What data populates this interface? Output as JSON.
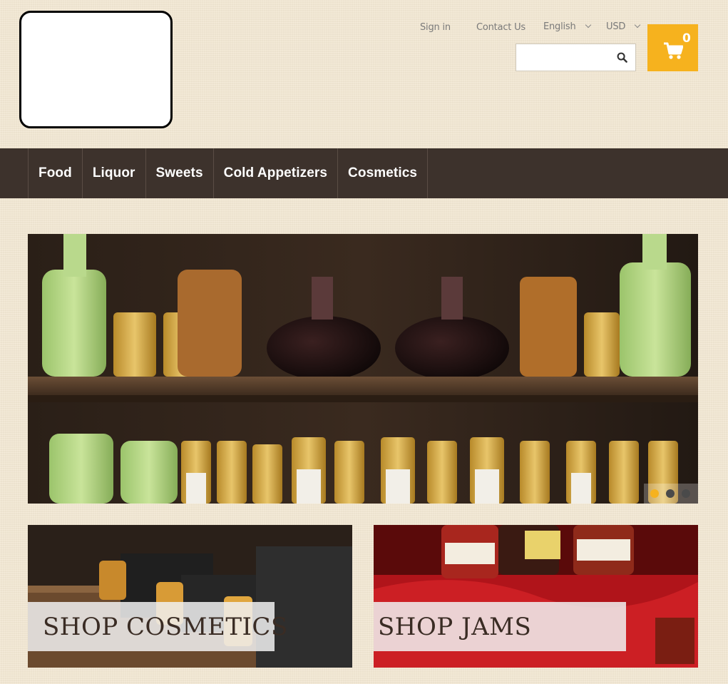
{
  "header": {
    "sign_in": "Sign in",
    "contact_us": "Contact Us",
    "language": "English",
    "currency": "USD",
    "search_placeholder": "",
    "cart_count": "0"
  },
  "nav": {
    "items": [
      {
        "label": "Food"
      },
      {
        "label": "Liquor"
      },
      {
        "label": "Sweets"
      },
      {
        "label": "Cold Appetizers"
      },
      {
        "label": "Cosmetics"
      }
    ]
  },
  "slider": {
    "slide_count": 3,
    "active_index": 0
  },
  "banners": [
    {
      "label": "SHOP COSMETICS"
    },
    {
      "label": "SHOP JAMS"
    }
  ],
  "colors": {
    "accent": "#f6b21e",
    "nav_bg": "#3d322c",
    "page_bg": "#f3e8d3"
  }
}
